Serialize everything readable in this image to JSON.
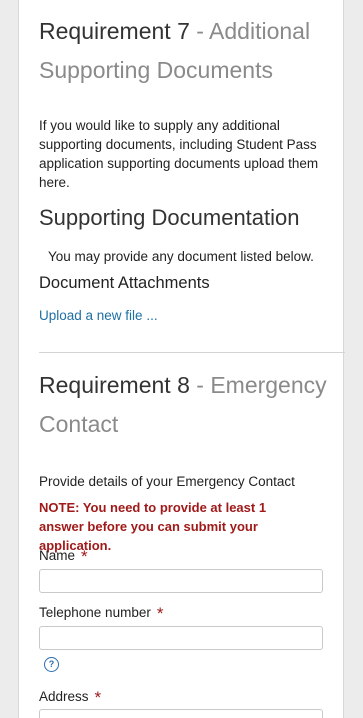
{
  "req7": {
    "number": "Requirement 7",
    "separator": " - ",
    "subtitle": "Additional Supporting Documents",
    "intro": "If you would like to supply any additional supporting documents, including Student Pass application supporting documents upload them here.",
    "support_heading": "Supporting Documentation",
    "support_text": "You may provide any document listed below.",
    "attachments_heading": "Document Attachments",
    "upload_link": "Upload a new file ..."
  },
  "req8": {
    "number": "Requirement 8",
    "separator": " - ",
    "subtitle": "Emergency Contact",
    "intro": "Provide details of your Emergency Contact",
    "note": "NOTE: You need to provide at least 1 answer before you can submit your application.",
    "fields": {
      "name_label": "Name",
      "phone_label": "Telephone number",
      "address_label": "Address",
      "required_marker": "*",
      "help_symbol": "?"
    }
  },
  "colors": {
    "required": "#a01a1a",
    "link": "#1f6fa3",
    "subtitle": "#8a8a8a"
  }
}
